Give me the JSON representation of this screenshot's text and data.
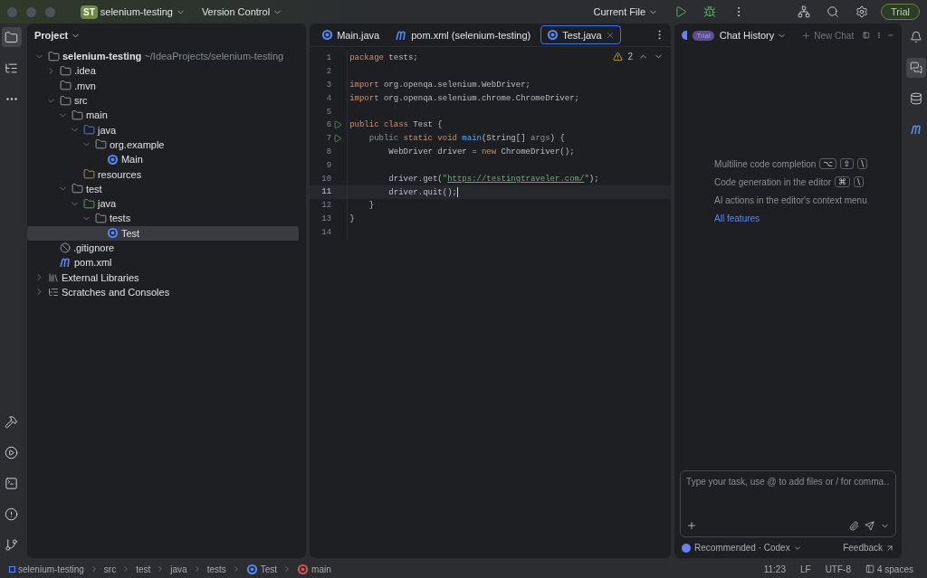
{
  "titlebar": {
    "project_badge": "ST",
    "project": "selenium-testing",
    "vcs": "Version Control",
    "run_config": "Current File",
    "trial": "Trial"
  },
  "project_panel": {
    "title": "Project",
    "tree": [
      {
        "label": "selenium-testing",
        "path": "~/IdeaProjects/selenium-testing",
        "kind": "module",
        "expanded": true,
        "selected": false,
        "children": [
          {
            "label": ".idea",
            "kind": "folder",
            "expanded": false,
            "selected": false
          },
          {
            "label": ".mvn",
            "kind": "folder",
            "selected": false
          },
          {
            "label": "src",
            "kind": "folder",
            "expanded": true,
            "selected": false,
            "children": [
              {
                "label": "main",
                "kind": "folder",
                "expanded": true,
                "selected": false,
                "children": [
                  {
                    "label": "java",
                    "kind": "source-folder",
                    "expanded": true,
                    "selected": false,
                    "children": [
                      {
                        "label": "org.example",
                        "kind": "package",
                        "expanded": true,
                        "selected": false,
                        "children": [
                          {
                            "label": "Main",
                            "kind": "class",
                            "selected": false
                          }
                        ]
                      }
                    ]
                  },
                  {
                    "label": "resources",
                    "kind": "resources",
                    "selected": false
                  }
                ]
              },
              {
                "label": "test",
                "kind": "folder",
                "expanded": true,
                "selected": false,
                "children": [
                  {
                    "label": "java",
                    "kind": "test-folder",
                    "expanded": true,
                    "selected": false,
                    "children": [
                      {
                        "label": "tests",
                        "kind": "package",
                        "expanded": true,
                        "selected": false,
                        "children": [
                          {
                            "label": "Test",
                            "kind": "class",
                            "selected": true
                          }
                        ]
                      }
                    ]
                  }
                ]
              }
            ]
          },
          {
            "label": ".gitignore",
            "kind": "ignore",
            "selected": false
          },
          {
            "label": "pom.xml",
            "kind": "maven",
            "selected": false
          }
        ]
      },
      {
        "label": "External Libraries",
        "kind": "libraries",
        "expanded": false,
        "selected": false
      },
      {
        "label": "Scratches and Consoles",
        "kind": "scratches",
        "expanded": false,
        "selected": false
      }
    ]
  },
  "editor": {
    "tabs": [
      {
        "label": "Main.java",
        "kind": "class",
        "selected": false
      },
      {
        "label": "pom.xml (selenium-testing)",
        "kind": "maven",
        "selected": false
      },
      {
        "label": "Test.java",
        "kind": "class",
        "selected": true
      }
    ],
    "warnings": "2",
    "lines": [
      {
        "number": "1",
        "run": false,
        "current": false,
        "tokens": [
          {
            "t": "package",
            "kind": "kw"
          },
          {
            "t": " tests;",
            "kind": "plain"
          }
        ]
      },
      {
        "number": "2",
        "run": false,
        "current": false
      },
      {
        "number": "3",
        "run": false,
        "current": false,
        "tokens": [
          {
            "t": "import",
            "kind": "kw"
          },
          {
            "t": " org.openqa.selenium.WebDriver;",
            "kind": "plain"
          }
        ]
      },
      {
        "number": "4",
        "run": false,
        "current": false,
        "tokens": [
          {
            "t": "import",
            "kind": "kw"
          },
          {
            "t": " org.openqa.selenium.chrome.ChromeDriver;",
            "kind": "plain"
          }
        ]
      },
      {
        "number": "5",
        "run": false,
        "current": false
      },
      {
        "number": "6",
        "run": true,
        "current": false,
        "tokens": [
          {
            "t": "public class",
            "kind": "kw"
          },
          {
            "t": " Test {",
            "kind": "plain"
          }
        ]
      },
      {
        "number": "7",
        "run": true,
        "current": false,
        "tokens": [
          {
            "t": "    public",
            "kind": "dim"
          },
          {
            "t": " static void ",
            "kind": "kw"
          },
          {
            "t": "main",
            "kind": "fn"
          },
          {
            "t": "(String[] ",
            "kind": "plain"
          },
          {
            "t": "args",
            "kind": "dim"
          },
          {
            "t": ") {",
            "kind": "plain"
          }
        ]
      },
      {
        "number": "8",
        "run": false,
        "current": false,
        "tokens": [
          {
            "t": "        WebDriver driver = ",
            "kind": "plain"
          },
          {
            "t": "new",
            "kind": "kw"
          },
          {
            "t": " ChromeDriver();",
            "kind": "plain"
          }
        ]
      },
      {
        "number": "9",
        "run": false,
        "current": false
      },
      {
        "number": "10",
        "run": false,
        "current": false,
        "tokens": [
          {
            "t": "        driver.get(",
            "kind": "plain"
          },
          {
            "t": "\"",
            "kind": "str"
          },
          {
            "t": "https://testingtraveler.com/",
            "kind": "url"
          },
          {
            "t": "\"",
            "kind": "str"
          },
          {
            "t": ");",
            "kind": "plain"
          }
        ]
      },
      {
        "number": "11",
        "run": false,
        "current": true,
        "tokens": [
          {
            "t": "        driver.quit();",
            "kind": "plain"
          }
        ]
      },
      {
        "number": "12",
        "run": false,
        "current": false,
        "tokens": [
          {
            "t": "    }",
            "kind": "plain"
          }
        ]
      },
      {
        "number": "13",
        "run": false,
        "current": false,
        "tokens": [
          {
            "t": "}",
            "kind": "plain"
          }
        ]
      },
      {
        "number": "14",
        "run": false,
        "current": false
      }
    ]
  },
  "chat": {
    "badge": "Trial",
    "title": "Chat History",
    "new_chat": "New Chat",
    "hints": [
      {
        "text": "Multiline code completion",
        "keys": [
          "⌥",
          "⇧",
          "\\"
        ]
      },
      {
        "text": "Code generation in the editor",
        "keys": [
          "⌘",
          "\\"
        ]
      },
      {
        "text": "AI actions in the editor's context menu"
      }
    ],
    "link": "All features",
    "input": {
      "placeholder": "Type your task, use @ to add files or / for comma…"
    },
    "model": "Recommended · Codex",
    "feedback": "Feedback"
  },
  "status_bar": {
    "breadcrumbs": [
      {
        "label": "selenium-testing",
        "kind": "module"
      },
      {
        "label": "src",
        "kind": "none"
      },
      {
        "label": "test",
        "kind": "none"
      },
      {
        "label": "java",
        "kind": "none"
      },
      {
        "label": "tests",
        "kind": "none"
      },
      {
        "label": "Test",
        "kind": "class"
      },
      {
        "label": "main",
        "kind": "method"
      }
    ],
    "position": "11:23",
    "line_ending": "LF",
    "encoding": "UTF-8",
    "indent": "4 spaces"
  }
}
